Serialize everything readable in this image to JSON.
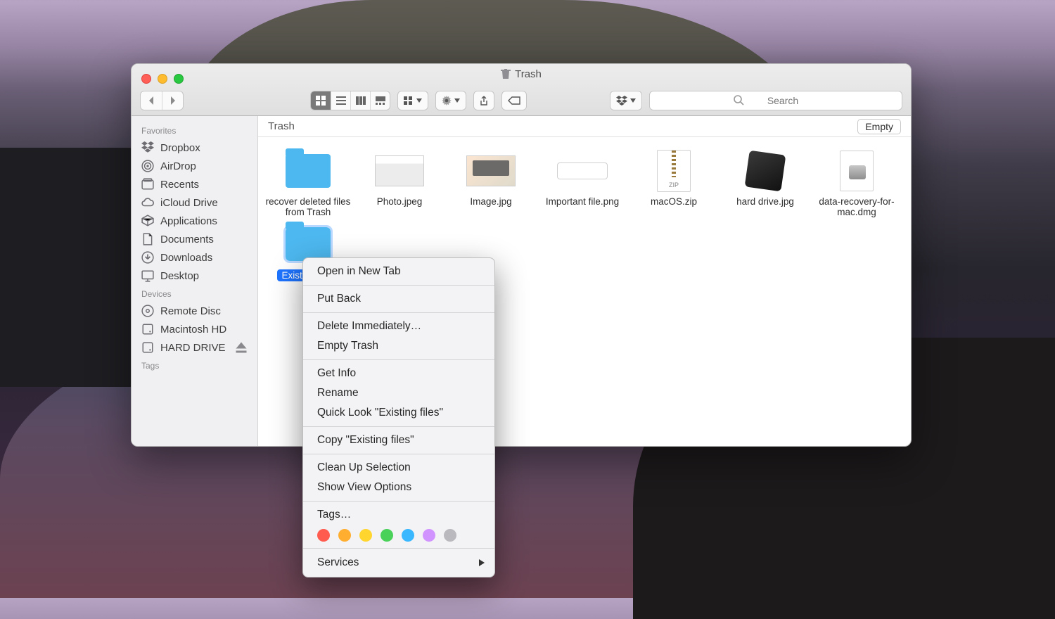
{
  "window": {
    "title": "Trash"
  },
  "toolbar": {
    "search_placeholder": "Search"
  },
  "sidebar": {
    "sections": [
      {
        "header": "Favorites",
        "items": [
          {
            "label": "Dropbox",
            "icon": "dropbox"
          },
          {
            "label": "AirDrop",
            "icon": "airdrop"
          },
          {
            "label": "Recents",
            "icon": "recents"
          },
          {
            "label": "iCloud Drive",
            "icon": "cloud"
          },
          {
            "label": "Applications",
            "icon": "apps"
          },
          {
            "label": "Documents",
            "icon": "doc"
          },
          {
            "label": "Downloads",
            "icon": "downloads"
          },
          {
            "label": "Desktop",
            "icon": "desktop"
          }
        ]
      },
      {
        "header": "Devices",
        "items": [
          {
            "label": "Remote Disc",
            "icon": "disc"
          },
          {
            "label": "Macintosh HD",
            "icon": "hdd"
          },
          {
            "label": "HARD DRIVE",
            "icon": "hdd",
            "ejectable": true
          }
        ]
      },
      {
        "header": "Tags",
        "items": []
      }
    ]
  },
  "location": {
    "path": "Trash",
    "empty_button": "Empty"
  },
  "files": [
    {
      "name": "recover deleted files from Trash",
      "kind": "folder"
    },
    {
      "name": "Photo.jpeg",
      "kind": "photo"
    },
    {
      "name": "Image.jpg",
      "kind": "image"
    },
    {
      "name": "Important file.png",
      "kind": "png"
    },
    {
      "name": "macOS.zip",
      "kind": "zip"
    },
    {
      "name": "hard drive.jpg",
      "kind": "hd"
    },
    {
      "name": "data-recovery-for-mac.dmg",
      "kind": "dmg"
    },
    {
      "name": "Existing files",
      "kind": "folder",
      "selected": true
    }
  ],
  "context_menu": {
    "groups": [
      [
        "Open in New Tab"
      ],
      [
        "Put Back"
      ],
      [
        "Delete Immediately…",
        "Empty Trash"
      ],
      [
        "Get Info",
        "Rename",
        "Quick Look \"Existing files\""
      ],
      [
        "Copy \"Existing files\""
      ],
      [
        "Clean Up Selection",
        "Show View Options"
      ],
      [
        "Tags…"
      ]
    ],
    "tag_colors": [
      "#ff5b4f",
      "#ffae2f",
      "#ffd52e",
      "#49d15a",
      "#39b7ff",
      "#d193ff",
      "#b9b9be"
    ],
    "services_label": "Services"
  }
}
